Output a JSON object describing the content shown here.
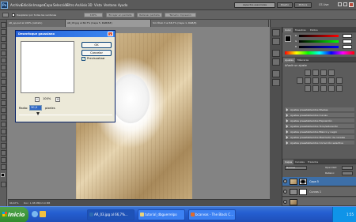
{
  "app": {
    "logo_label": "Ps",
    "menu": [
      "Archivo",
      "Edición",
      "Imagen",
      "Capa",
      "Selección",
      "Filtro",
      "Análisis",
      "3D",
      "Vista",
      "Ventana",
      "Ayuda"
    ],
    "workspace_buttons": [
      "Aspectos esenciales",
      "Diseño",
      "Pintura"
    ],
    "cs_live": "CS Live"
  },
  "options_bar": {
    "checkbox_label": "Desplazar por todas las ventanas",
    "buttons": [
      "100%",
      "Encajar en pantalla",
      "Rellenar pantalla",
      "Tamaño impresión"
    ]
  },
  "document_tabs": [
    "AR_ap.psd al 100% (retrato)",
    "AR_03.jpg al 66,7% (Capa 5, RGB/8#)",
    "Sin título 3 al 66,7% (Capa 1, RGB/8)"
  ],
  "status_bar": {
    "zoom": "66,67%",
    "doc_info": "Doc: 1,38 MB/13,0 MB"
  },
  "dialog": {
    "title": "Desenfoque gaussiano",
    "ok_label": "OK",
    "cancel_label": "Cancelar",
    "preview_label": "Previsualizar",
    "preview_checked": true,
    "zoom_out": "−",
    "zoom_in": "+",
    "zoom_level": "100%",
    "radius_label": "Radio:",
    "radius_value": "30,0",
    "radius_unit": "píxeles",
    "close_glyph": "x"
  },
  "panels": {
    "color": {
      "tabs": [
        "Color",
        "Muestras",
        "Estilos"
      ],
      "channels": [
        "R",
        "G",
        "B"
      ],
      "values": [
        "",
        "",
        ""
      ]
    },
    "adjustments": {
      "tabs": [
        "Ajustes",
        "Máscaras"
      ],
      "heading": "Añadir un ajuste",
      "presets": [
        "Ajustes preestablecidos Niveles",
        "Ajustes preestablecidos Curvas",
        "Ajustes preestablecidos Exposición",
        "Ajustes preestablecidos Tono/saturación",
        "Ajustes preestablecidos Blanco y negro",
        "Ajustes preestablecidos Mezclador de canales",
        "Ajustes preestablecidos Corrección selectiva"
      ]
    },
    "layers": {
      "tabs": [
        "Capas",
        "Canales",
        "Trazados"
      ],
      "blend_label": "Normal",
      "opacity_label": "Opacidad:",
      "fill_label": "Relleno:",
      "rows": [
        {
          "name": "Capa 5",
          "active": true
        },
        {
          "name": "Curvas 1",
          "active": false
        },
        {
          "name": "",
          "active": false
        }
      ]
    }
  },
  "taskbar": {
    "start_label": "Inicio",
    "items": [
      {
        "label": "AR_03.jpg al 66,7%...",
        "active": true
      },
      {
        "label": "tutorial_dbguerrelpo",
        "active": false
      },
      {
        "label": "bcanvas - The Black C...",
        "active": false
      }
    ],
    "clock": "1:55"
  },
  "colors": {
    "accent_blue": "#3d6fa8",
    "dialog_title": "#2560d8",
    "taskbar": "#245ed0",
    "start_green": "#3c9a38"
  }
}
